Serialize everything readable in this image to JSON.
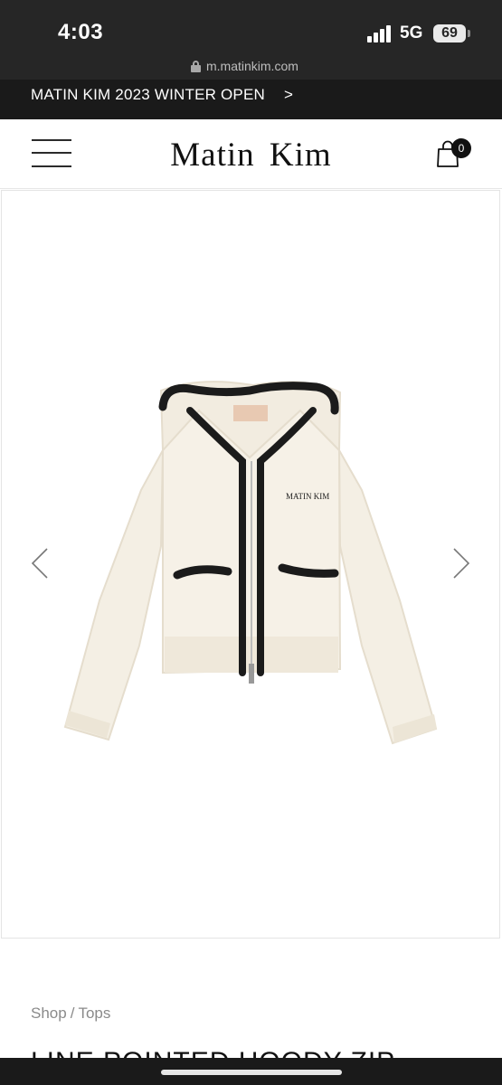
{
  "status_bar": {
    "time": "4:03",
    "network": "5G",
    "battery": "69",
    "signal_icon": "cellular-signal-icon"
  },
  "browser": {
    "url": "m.matinkim.com",
    "lock_icon": "lock-icon"
  },
  "announcement": {
    "text": "MATIN KIM 2023 WINTER OPEN",
    "arrow": ">"
  },
  "header": {
    "brand": "Matin Kim",
    "menu_icon": "hamburger-menu-icon",
    "cart_icon": "shopping-bag-icon",
    "cart_count": "0"
  },
  "gallery": {
    "prev_icon": "chevron-left-icon",
    "next_icon": "chevron-right-icon",
    "garment_logo": "MATIN KIM"
  },
  "product": {
    "breadcrumb": [
      "Shop",
      "Tops"
    ],
    "breadcrumb_separator": "/",
    "title": "LINE POINTED HOODY ZIP"
  },
  "colors": {
    "dark_bar": "#262626",
    "announcement_bg": "#1a1a1a",
    "text_primary": "#111111",
    "text_muted": "#8a8a8a",
    "garment_cream": "#f4efe4",
    "garment_trim": "#1b1b1b"
  }
}
